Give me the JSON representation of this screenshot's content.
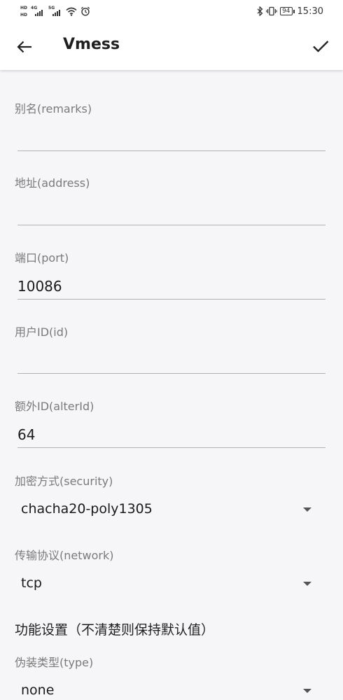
{
  "status_bar": {
    "hd_top": "HD",
    "hd_bottom": "HD",
    "net1": "4G",
    "net2": "5G",
    "battery": "94",
    "time": "15:30"
  },
  "toolbar": {
    "title": "Vmess"
  },
  "form": {
    "remarks": {
      "label": "别名(remarks)",
      "value": ""
    },
    "address": {
      "label": "地址(address)",
      "value": ""
    },
    "port": {
      "label": "端口(port)",
      "value": "10086"
    },
    "id": {
      "label": "用户ID(id)",
      "value": ""
    },
    "alter_id": {
      "label": "额外ID(alterId)",
      "value": "64"
    },
    "security": {
      "label": "加密方式(security)",
      "value": "chacha20-poly1305"
    },
    "network": {
      "label": "传输协议(network)",
      "value": "tcp"
    },
    "section_title": "功能设置（不清楚则保持默认值）",
    "type": {
      "label": "伪装类型(type)",
      "value": "none"
    }
  }
}
